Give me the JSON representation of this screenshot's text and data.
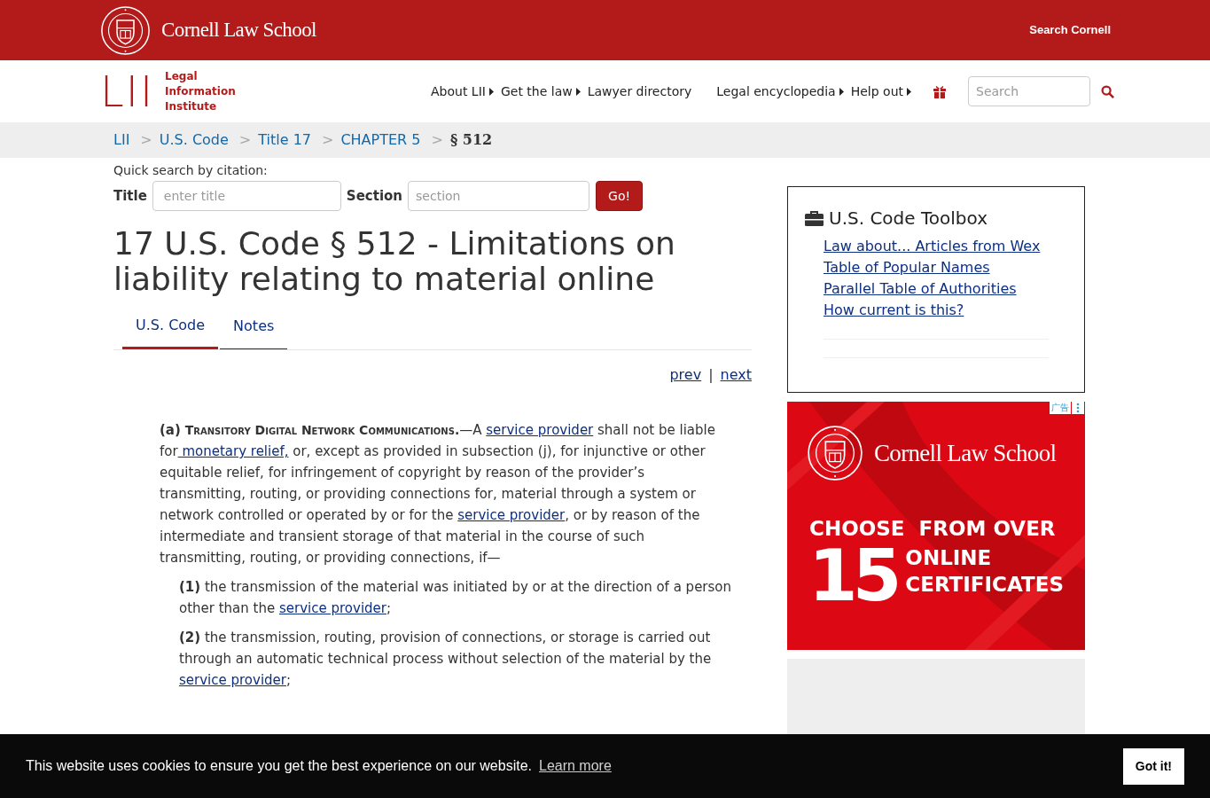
{
  "top_bar": {
    "brand": "Cornell Law School",
    "search_link": "Search Cornell"
  },
  "lii": {
    "logo": "LII",
    "name_lines": [
      "Legal",
      "Information",
      "Institute"
    ]
  },
  "nav": [
    {
      "label": "About LII",
      "caret": true
    },
    {
      "label": "Get the law",
      "caret": true
    },
    {
      "label": "Lawyer directory",
      "caret": false
    },
    {
      "label": "Legal encyclopedia",
      "caret": true
    },
    {
      "label": "Help out",
      "caret": true
    }
  ],
  "site_search": {
    "placeholder": "Search"
  },
  "breadcrumbs": [
    {
      "label": "LII",
      "current": false
    },
    {
      "label": "U.S. Code",
      "current": false
    },
    {
      "label": "Title 17",
      "current": false
    },
    {
      "label": "CHAPTER 5",
      "current": false
    },
    {
      "label": "§ 512",
      "current": true
    }
  ],
  "breadcrumb_separator": ">",
  "quick_search": {
    "heading": "Quick search by citation:",
    "title_label": "Title",
    "title_placeholder": "enter title",
    "section_label": "Section",
    "section_placeholder": "section",
    "button": "Go!"
  },
  "page_title": "17 U.S. Code § 512 - Limitations on liability relating to material online",
  "tabs": [
    {
      "label": "U.S. Code",
      "selected": true
    },
    {
      "label": "Notes",
      "selected": false
    }
  ],
  "pager": {
    "prev": "prev",
    "separator": "|",
    "next": "next"
  },
  "paragraphs": [
    {
      "indent": false,
      "segments": [
        {
          "kind": "number",
          "text": "(a)"
        },
        {
          "kind": "heading",
          "text": " Transitory Digital Network Communications."
        },
        {
          "kind": "text",
          "text": "—A "
        },
        {
          "kind": "link",
          "text": "service provider"
        },
        {
          "kind": "text",
          "text": " shall not be liable for"
        },
        {
          "kind": "link",
          "text": " monetary relief,"
        },
        {
          "kind": "text",
          "text": " or, except as provided in subsection (j), for injunctive or other equitable relief, for infringement of copyright by reason of the provider’s transmitting, routing, or providing connections for, material through a system or network controlled or operated by or for the "
        },
        {
          "kind": "link",
          "text": "service provider"
        },
        {
          "kind": "text",
          "text": ", or by reason of the intermediate and transient storage of that material in the course of such transmitting, routing, or providing connections, if—"
        }
      ]
    },
    {
      "indent": true,
      "segments": [
        {
          "kind": "number",
          "text": "(1)"
        },
        {
          "kind": "text",
          "text": " the transmission of the material was initiated by or at the direction of a person other than the "
        },
        {
          "kind": "link",
          "text": "service provider"
        },
        {
          "kind": "text",
          "text": ";"
        }
      ]
    },
    {
      "indent": true,
      "segments": [
        {
          "kind": "number",
          "text": "(2)"
        },
        {
          "kind": "text",
          "text": " the transmission, routing, provision of connections, or storage is carried out through an automatic technical process without selection of the material by the "
        },
        {
          "kind": "link",
          "text": "service provider"
        },
        {
          "kind": "text",
          "text": ";"
        }
      ]
    }
  ],
  "toolbox": {
    "title": "U.S. Code Toolbox",
    "links": [
      "Law about... Articles from Wex",
      "Table of Popular Names",
      "Parallel Table of Authorities",
      "How current is this?"
    ]
  },
  "ad": {
    "badge": "广告",
    "brand": "Cornell Law School",
    "headline": "CHOOSE  FROM OVER",
    "number": "15",
    "lines": [
      "ONLINE",
      "CERTIFICATES"
    ]
  },
  "cookie": {
    "message": "This website uses cookies to ensure you get the best experience on our website.",
    "link": "Learn more",
    "button": "Got it!"
  }
}
